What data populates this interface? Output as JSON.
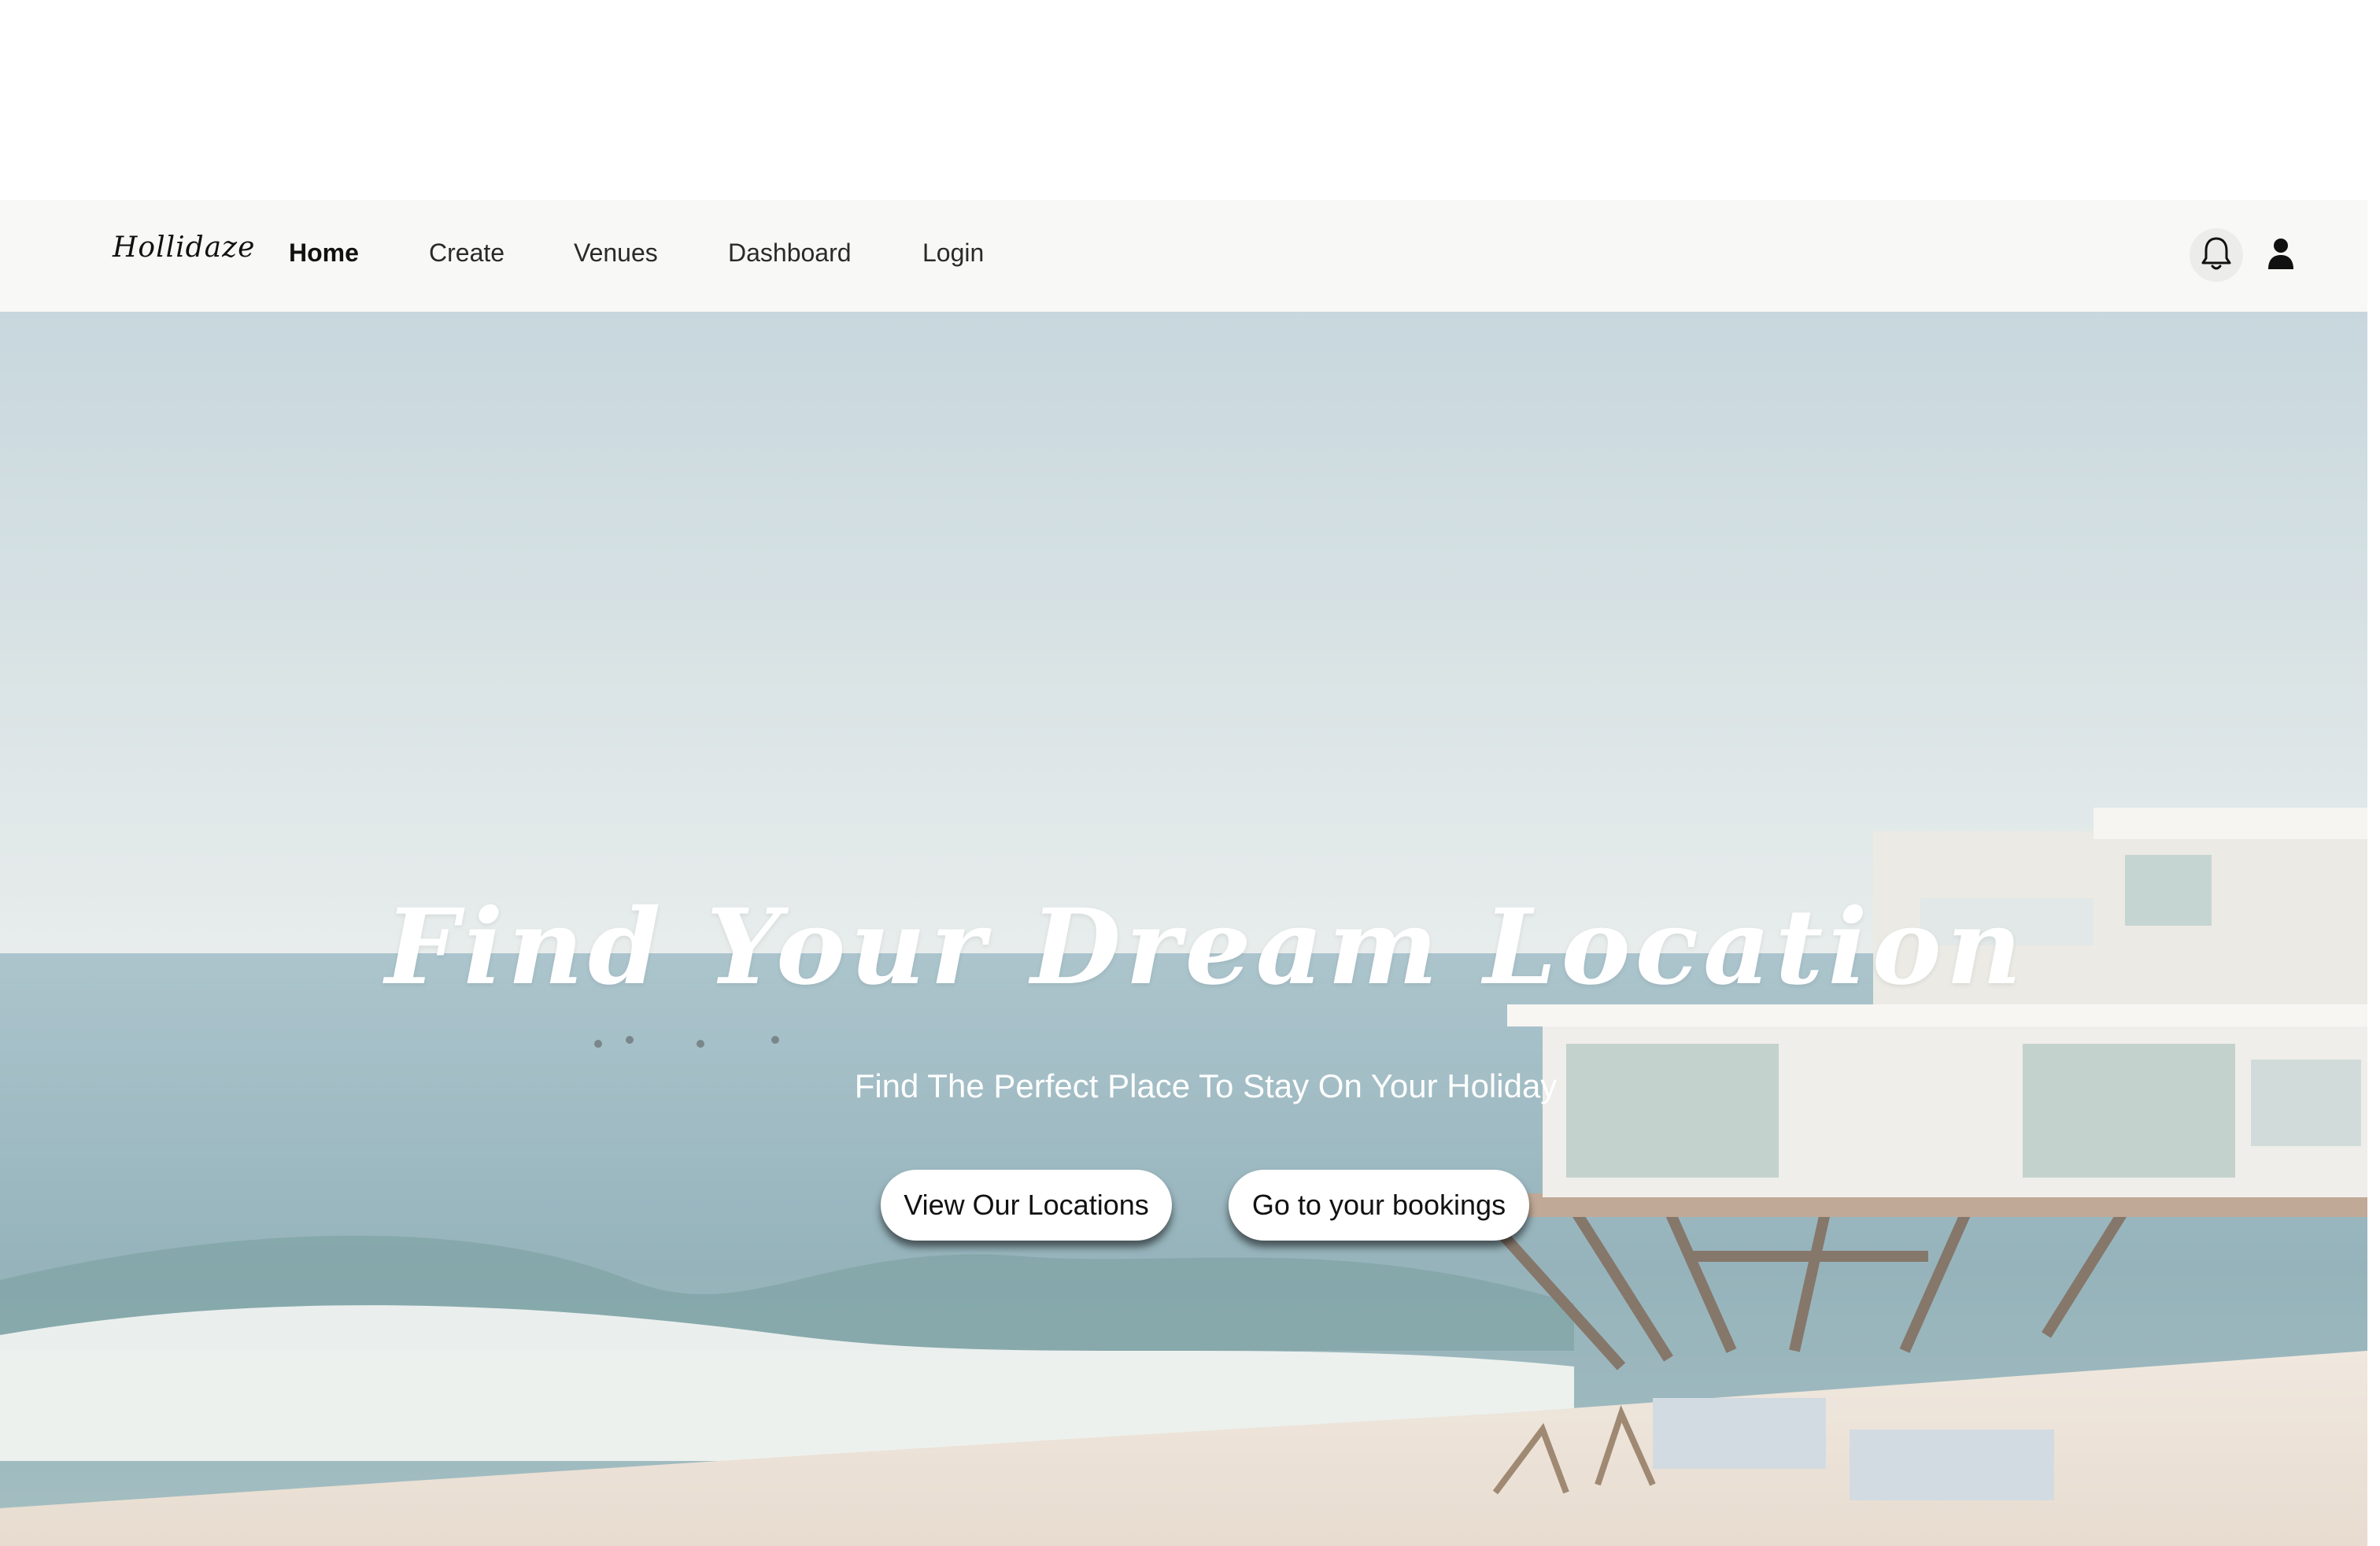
{
  "brand": {
    "logo_text": "Hollidaze"
  },
  "nav": {
    "links": [
      {
        "label": "Home",
        "active": true
      },
      {
        "label": "Create",
        "active": false
      },
      {
        "label": "Venues",
        "active": false
      },
      {
        "label": "Dashboard",
        "active": false
      },
      {
        "label": "Login",
        "active": false
      }
    ],
    "icons": [
      "bell-icon",
      "user-icon"
    ]
  },
  "hero": {
    "title": "Find Your Dream Location",
    "subtitle": "Find The Perfect Place To Stay On Your Holiday",
    "buttons": {
      "locations": "View Our Locations",
      "bookings": "Go to your bookings"
    },
    "image_description_colors": {
      "sky": "#c3d5dc",
      "sea": "#7fa4ae",
      "sand": "#e8ddd2",
      "house": "#ecebe6"
    }
  }
}
